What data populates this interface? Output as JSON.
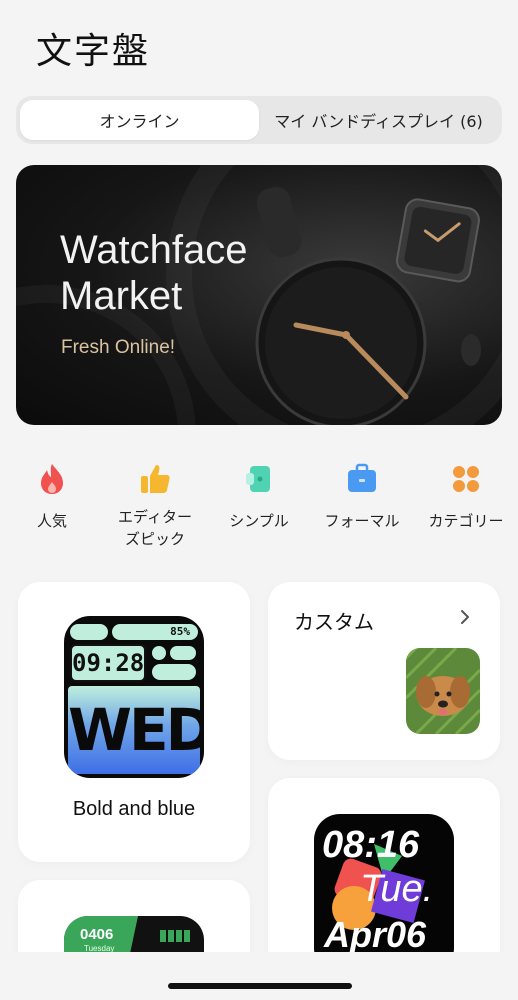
{
  "header": {
    "title": "文字盤"
  },
  "tabs": [
    {
      "label": "オンライン",
      "active": true
    },
    {
      "label": "マイ バンドディスプレイ (6)",
      "active": false
    }
  ],
  "banner": {
    "title": "Watchface\nMarket",
    "subtitle": "Fresh Online!"
  },
  "categories": [
    {
      "label": "人気",
      "icon": "flame-icon",
      "color": "#f0524f"
    },
    {
      "label": "エディター\nズピック",
      "icon": "thumbs-up-icon",
      "color": "#f6b730"
    },
    {
      "label": "シンプル",
      "icon": "simple-icon",
      "color": "#4fd3b3"
    },
    {
      "label": "フォーマル",
      "icon": "briefcase-icon",
      "color": "#4a9af2"
    },
    {
      "label": "カテゴリー",
      "icon": "grid-icon",
      "color": "#f39a3d"
    }
  ],
  "cards": {
    "bold_blue": {
      "name": "Bold and blue",
      "face": {
        "battery": "85%",
        "time": "09:28",
        "day": "WED"
      }
    },
    "custom": {
      "title": "カスタム"
    },
    "colorful": {
      "time": "08:16",
      "day": "Tue.",
      "date": "Apr06"
    },
    "green": {
      "time": "0406",
      "day": "Tuesday"
    }
  },
  "colors": {
    "accent_blue": "#3f6fe6",
    "face_mint": "#bfefdc"
  }
}
